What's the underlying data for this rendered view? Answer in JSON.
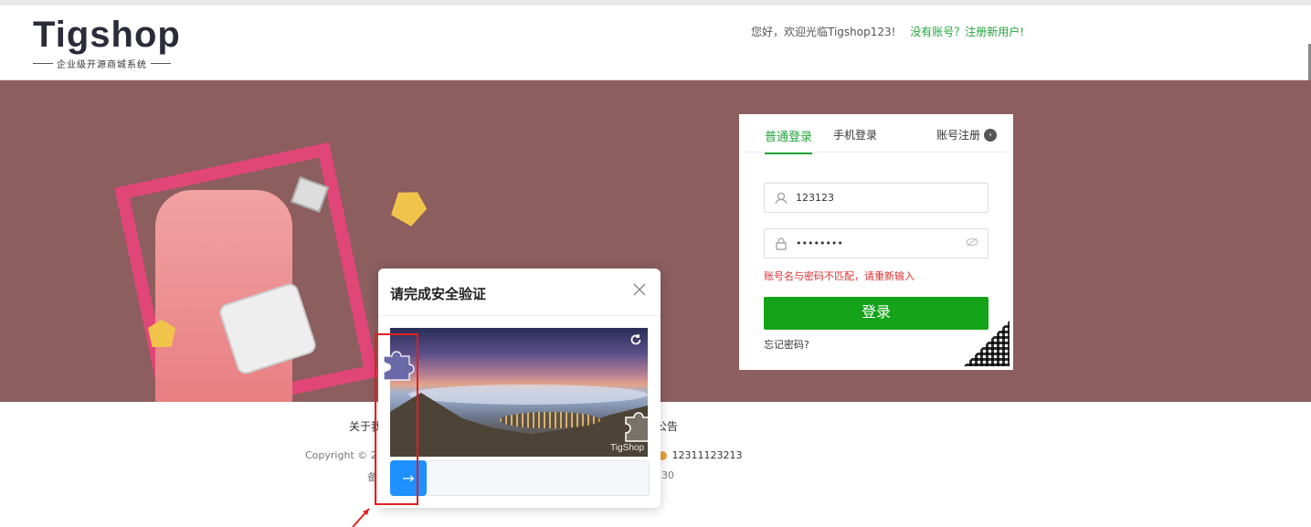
{
  "header": {
    "logo_text": "Tigshop",
    "logo_subtitle": "企业级开源商城系统",
    "greeting": "您好，欢迎光临Tigshop123!",
    "register_link": "没有账号？注册新用户!"
  },
  "login": {
    "tabs": [
      {
        "label": "普通登录",
        "active": true
      },
      {
        "label": "手机登录",
        "active": false
      }
    ],
    "register_label": "账号注册",
    "username_value": "123123",
    "password_value": "••••••••",
    "error_message": "账号名与密码不匹配，请重新输入",
    "submit_label": "登录",
    "forgot_label": "忘记密码?"
  },
  "footer": {
    "link_partial_left": "关于我",
    "link_partial_right": "公告",
    "copyright_partial": "Copyright © 2",
    "phone_partial": "12311123213",
    "line3_left": "备",
    "line3_right": "30"
  },
  "captcha": {
    "title": "请完成安全验证",
    "close_icon": "close-icon",
    "refresh_icon": "refresh-icon",
    "watermark": "TigShop",
    "slider_arrow": "→"
  },
  "colors": {
    "accent_green": "#20a53a",
    "submit_green": "#15a319",
    "error_red": "#d33333",
    "slider_blue": "#1e90ff",
    "banner_bg": "#8c5e5e",
    "highlight_red": "#e02020"
  }
}
